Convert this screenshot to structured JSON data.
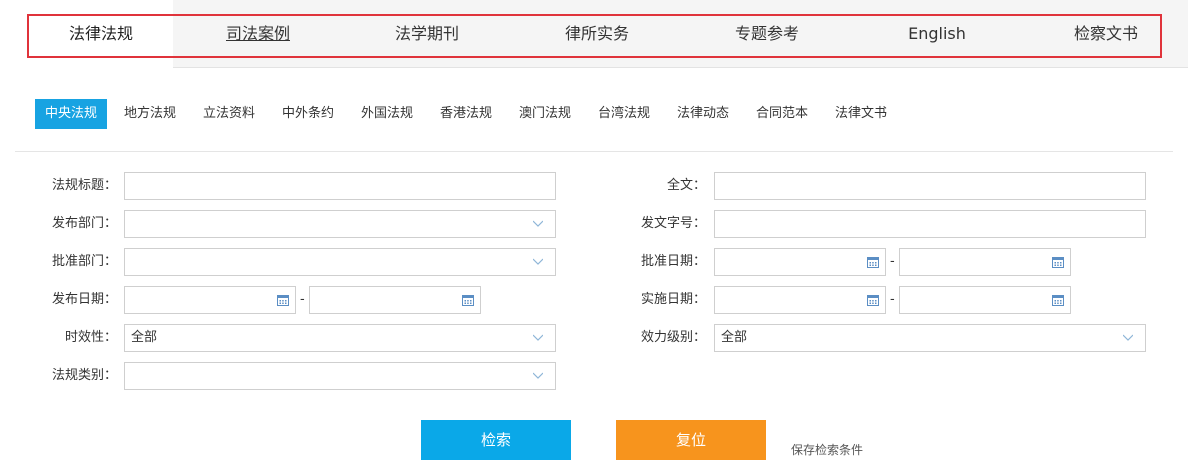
{
  "top_tabs": [
    {
      "label": "法律法规"
    },
    {
      "label": "司法案例"
    },
    {
      "label": "法学期刊"
    },
    {
      "label": "律所实务"
    },
    {
      "label": "专题参考"
    },
    {
      "label": "English"
    },
    {
      "label": "检察文书"
    }
  ],
  "sub_tabs": [
    {
      "label": "中央法规"
    },
    {
      "label": "地方法规"
    },
    {
      "label": "立法资料"
    },
    {
      "label": "中外条约"
    },
    {
      "label": "外国法规"
    },
    {
      "label": "香港法规"
    },
    {
      "label": "澳门法规"
    },
    {
      "label": "台湾法规"
    },
    {
      "label": "法律动态"
    },
    {
      "label": "合同范本"
    },
    {
      "label": "法律文书"
    }
  ],
  "form": {
    "title_label": "法规标题：",
    "fulltext_label": "全文：",
    "dept_label": "发布部门：",
    "docno_label": "发文字号：",
    "approve_dept_label": "批准部门：",
    "approve_date_label": "批准日期：",
    "publish_date_label": "发布日期：",
    "effective_date_label": "实施日期：",
    "validity_label": "时效性：",
    "validity_value": "全部",
    "level_label": "效力级别：",
    "level_value": "全部",
    "category_label": "法规类别：",
    "range_sep": "-"
  },
  "buttons": {
    "search": "检索",
    "reset": "复位",
    "save": "保存检索条件"
  },
  "colors": {
    "accent_blue": "#0aa8e8",
    "accent_orange": "#f7941d",
    "highlight_red": "#e0333b"
  }
}
